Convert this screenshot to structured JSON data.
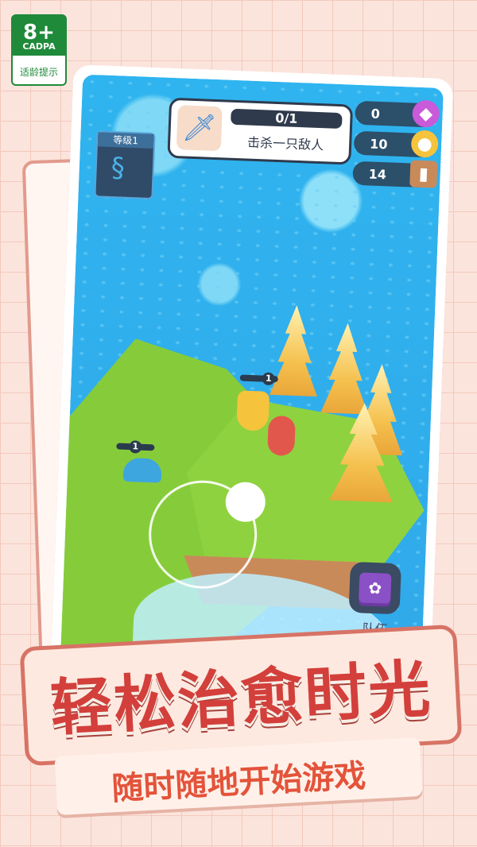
{
  "age_rating": {
    "age": "8+",
    "org": "CADPA",
    "note": "适龄提示"
  },
  "quest": {
    "progress": "0/1",
    "task": "击杀一只敌人",
    "icon": "sword-icon"
  },
  "resources": [
    {
      "value": "0",
      "icon": "gem-icon",
      "color": "#c95ad9"
    },
    {
      "value": "10",
      "icon": "coin-icon",
      "color": "#f6c33d"
    },
    {
      "value": "14",
      "icon": "wood-icon",
      "color": "#c98a5a"
    }
  ],
  "level_card": {
    "label": "等级1"
  },
  "hero": {
    "level": "1"
  },
  "enemy_blue": {
    "level": "1"
  },
  "team_button": {
    "label": "队伍"
  },
  "banner": {
    "title": "轻松治愈时光",
    "subtitle": "随时随地开始游戏"
  }
}
